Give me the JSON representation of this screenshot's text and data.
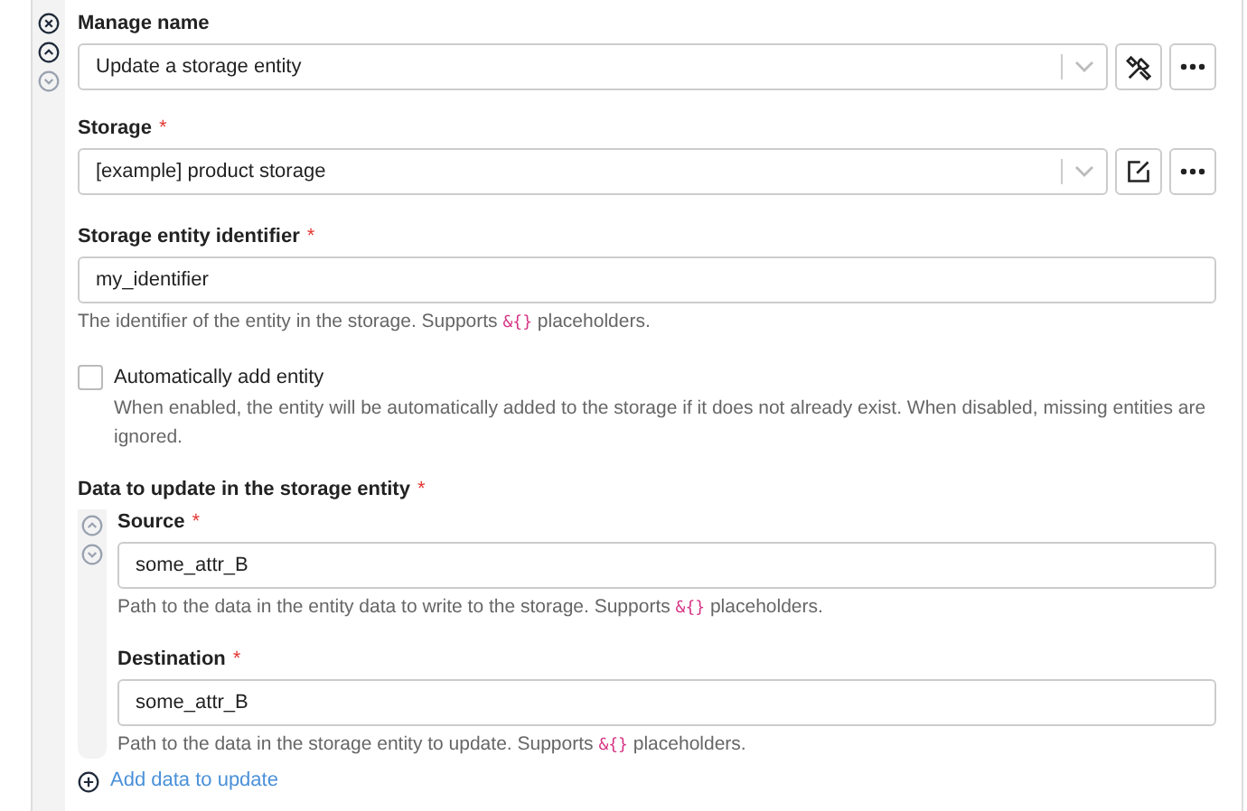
{
  "action": {
    "label": "Manage name",
    "value": "Update a storage entity"
  },
  "storage": {
    "label": "Storage",
    "required_mark": "*",
    "value": "[example] product storage"
  },
  "identifier": {
    "label": "Storage entity identifier",
    "required_mark": "*",
    "value": "my_identifier",
    "help": {
      "before": "The identifier of the entity in the storage. Supports",
      "code": "&{}",
      "after": "placeholders."
    }
  },
  "auto_add": {
    "label": "Automatically add entity",
    "checked": false,
    "description": "When enabled, the entity will be automatically added to the storage if it does not already exist. When disabled, missing entities are ignored."
  },
  "data_section": {
    "label": "Data to update in the storage entity",
    "required_mark": "*",
    "fields": [
      {
        "label": "Source",
        "required_mark": "*",
        "value": "some_attr_B",
        "help": {
          "before": "Path to the data in the entity data to write to the storage. Supports",
          "code": "&{}",
          "after": "placeholders."
        }
      },
      {
        "label": "Destination",
        "required_mark": "*",
        "value": "some_attr_B",
        "help": {
          "before": "Path to the data in the storage entity to update. Supports",
          "code": "&{}",
          "after": "placeholders."
        }
      }
    ],
    "add_link": "Add data to update"
  }
}
